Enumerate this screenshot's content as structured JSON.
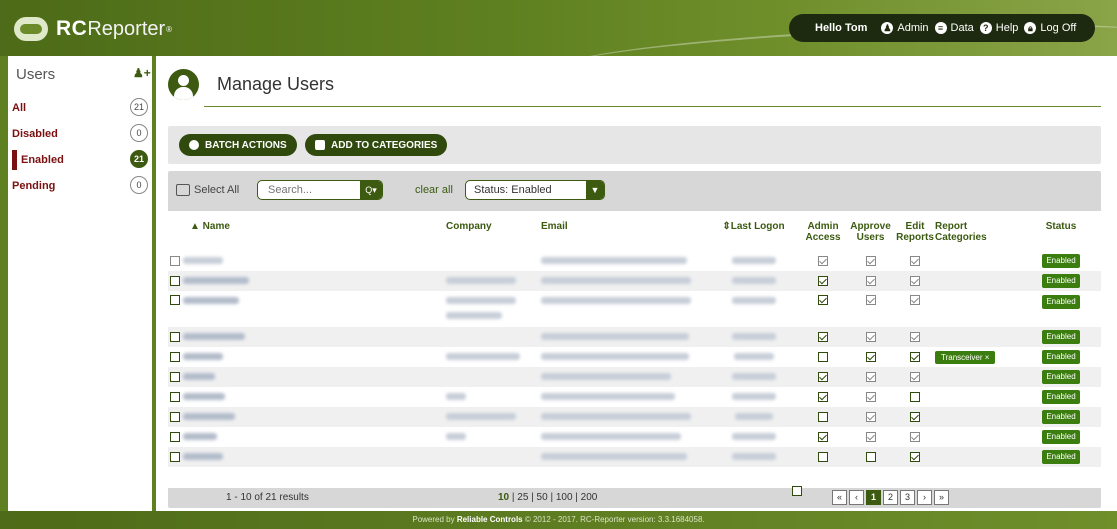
{
  "app": {
    "logo_rc": "RC",
    "logo_rest": "Reporter",
    "logo_reg": "®"
  },
  "userbar": {
    "greeting": "Hello Tom",
    "admin": "Admin",
    "data": "Data",
    "help": "Help",
    "logoff": "Log Off"
  },
  "sidebar": {
    "title": "Users",
    "items": [
      {
        "label": "All",
        "count": "21"
      },
      {
        "label": "Disabled",
        "count": "0"
      },
      {
        "label": "Enabled",
        "count": "21"
      },
      {
        "label": "Pending",
        "count": "0"
      }
    ]
  },
  "page": {
    "title": "Manage Users"
  },
  "actions": {
    "batch": "BATCH ACTIONS",
    "categories": "ADD TO CATEGORIES"
  },
  "filter": {
    "select_all": "Select All",
    "search_placeholder": "Search...",
    "clear_all": "clear all",
    "status": "Status: Enabled"
  },
  "table": {
    "headers": {
      "name": "▲ Name",
      "company": "Company",
      "email": "Email",
      "last_logon": "⇕Last Logon",
      "admin1": "Admin",
      "admin2": "Access",
      "approve1": "Approve",
      "approve2": "Users",
      "edit1": "Edit",
      "edit2": "Reports",
      "report1": "Report",
      "report2": "Categories",
      "status": "Status"
    },
    "status_badge": "Enabled",
    "category_tag": "Transceiver ×"
  },
  "footer_bar": {
    "results": "1 - 10 of 21 results",
    "page_sizes": {
      "cur": "10",
      "rest": " | 25 | 50 | 100 | 200"
    },
    "pager": [
      "«",
      "‹",
      "1",
      "2",
      "3",
      "›",
      "»"
    ]
  },
  "footer": {
    "prefix": "Powered by ",
    "brand": "Reliable Controls",
    "suffix": " © 2012 - 2017. RC-Reporter version: 3.3.1684058."
  }
}
